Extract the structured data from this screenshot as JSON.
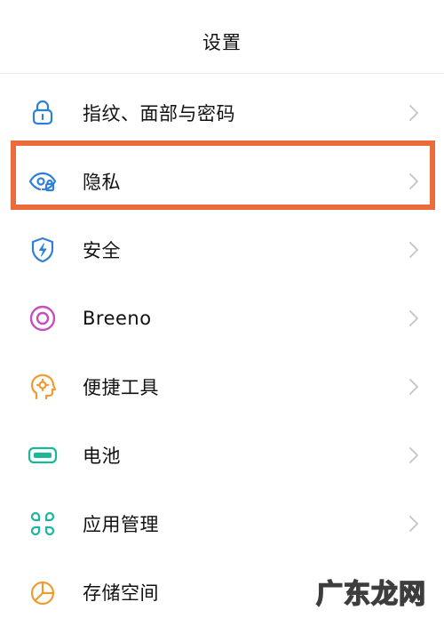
{
  "header": {
    "title": "设置"
  },
  "rows": [
    {
      "label": "指纹、面部与密码",
      "icon": "lock-icon",
      "color": "#2f7fd8"
    },
    {
      "label": "隐私",
      "icon": "eye-lock-icon",
      "color": "#2f7fd8"
    },
    {
      "label": "安全",
      "icon": "shield-icon",
      "color": "#2f7fd8"
    },
    {
      "label": "Breeno",
      "icon": "breeno-icon",
      "color": "#c54fbf"
    },
    {
      "label": "便捷工具",
      "icon": "head-tool-icon",
      "color": "#f19b2e"
    },
    {
      "label": "电池",
      "icon": "battery-icon",
      "color": "#1cb79a"
    },
    {
      "label": "应用管理",
      "icon": "app-grid-icon",
      "color": "#1cb79a"
    },
    {
      "label": "存储空间",
      "icon": "storage-pie-icon",
      "color": "#f19b2e"
    }
  ],
  "highlight_color": "#ec6b3a",
  "watermark": "广东龙网"
}
